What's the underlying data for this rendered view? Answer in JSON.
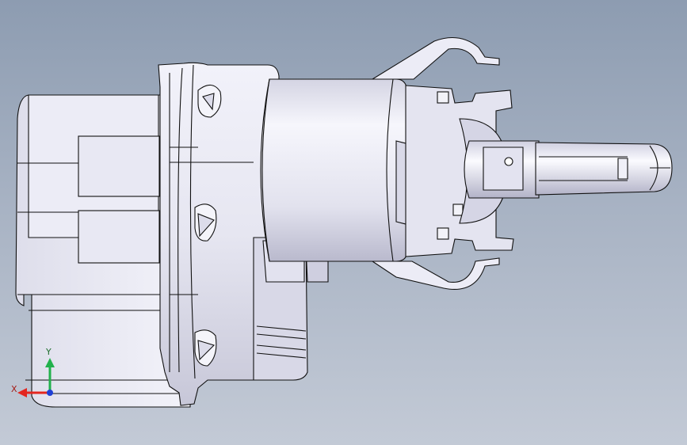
{
  "viewport": {
    "background_top": "#8d9cb1",
    "background_bottom": "#c3cad6",
    "model_fill": "#e9e9f4",
    "model_shade": "#c9c9da",
    "edge_color": "#111111"
  },
  "triad": {
    "x_label": "X",
    "y_label": "Y",
    "x_color": "#e3261f",
    "y_color": "#22b14c",
    "z_color": "#1f3fd6"
  }
}
